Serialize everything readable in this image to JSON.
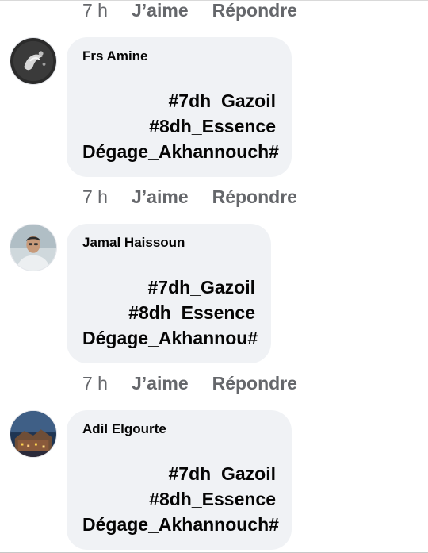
{
  "actions": {
    "time": "7 h",
    "like": "J’aime",
    "reply": "Répondre"
  },
  "comments": [
    {
      "author": "Frs Amine",
      "lines": [
        "#7dh_Gazoil",
        "#8dh_Essence",
        "Dégage_Akhannouch#"
      ],
      "avatar_icon": "dark-spray-avatar"
    },
    {
      "author": "Jamal Haissoun",
      "lines": [
        "#7dh_Gazoil",
        "#8dh_Essence",
        "Dégage_Akhannou#"
      ],
      "avatar_icon": "man-portrait-avatar"
    },
    {
      "author": "Adil Elgourte",
      "lines": [
        "#7dh_Gazoil",
        "#8dh_Essence",
        "Dégage_Akhannouch#"
      ],
      "avatar_icon": "night-city-avatar"
    }
  ]
}
